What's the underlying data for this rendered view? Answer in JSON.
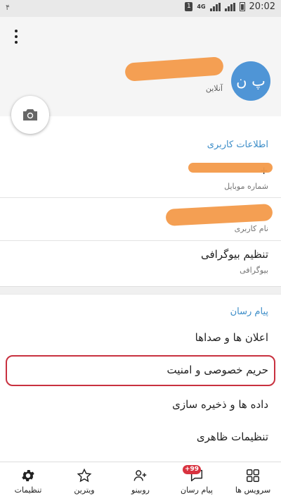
{
  "status_bar": {
    "left_text": "۴",
    "sim_label": "1",
    "network_label": "4G",
    "time": "20:02"
  },
  "profile": {
    "avatar_initials": "پ ن",
    "name": "",
    "status": "آنلاین",
    "redact_color": "#f39a4a"
  },
  "user_info": {
    "section_title": "اطلاعات کاربری",
    "phone_value": "+",
    "phone_label": "شماره موبایل",
    "username_value": "",
    "username_label": "نام کاربری",
    "bio_value": "تنظیم بیوگرافی",
    "bio_label": "بیوگرافی"
  },
  "messenger": {
    "section_title": "پیام رسان",
    "items": [
      "اعلان ها و صداها",
      "حریم خصوصی و امنیت",
      "داده ها و ذخیره سازی",
      "تنظیمات ظاهری"
    ],
    "highlighted_item_index": 1,
    "highlight_color": "#c8313f"
  },
  "bottom_nav": {
    "items": [
      {
        "label": "تنظیمات",
        "icon": "gear-icon",
        "active": true
      },
      {
        "label": "ویترین",
        "icon": "star-icon",
        "active": false
      },
      {
        "label": "روبینو",
        "icon": "add-user-icon",
        "active": false
      },
      {
        "label": "پیام رسان",
        "icon": "chat-icon",
        "active": false,
        "badge": "+99"
      },
      {
        "label": "سرویس ها",
        "icon": "grid-icon",
        "active": false
      }
    ]
  },
  "colors": {
    "accent": "#3c8dc8",
    "avatar": "#4f95d6",
    "badge": "#d8323f"
  }
}
